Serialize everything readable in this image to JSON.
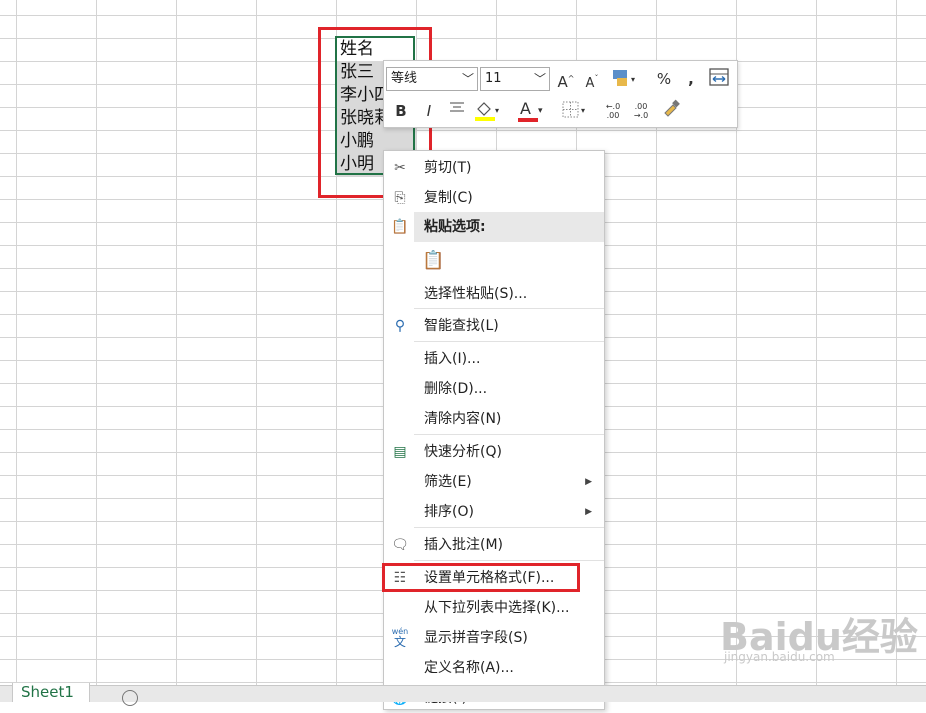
{
  "cells": [
    "姓名",
    "张三",
    "李小四",
    "张晓莉",
    "小鹏",
    "小明"
  ],
  "mini_toolbar": {
    "font_name": "等线",
    "font_size": "11",
    "increase_font_label": "A",
    "decrease_font_label": "A",
    "percent_label": "%",
    "comma_label": ",",
    "bold_label": "B",
    "italic_label": "I",
    "font_color_label": "A",
    "font_color": "#e0242a",
    "fill_color": "#ffff00",
    "inc_decimal_label": ".0\n.00",
    "dec_decimal_label": ".00\n.0"
  },
  "context_menu": {
    "items": [
      {
        "label": "剪切(T)",
        "icon": "scissors-icon"
      },
      {
        "label": "复制(C)",
        "icon": "copy-icon"
      },
      {
        "label": "粘贴选项:",
        "icon": "paste-icon"
      },
      {
        "label": "选择性粘贴(S)...",
        "icon": ""
      },
      {
        "label": "智能查找(L)",
        "icon": "smart-lookup-icon"
      },
      {
        "label": "插入(I)...",
        "icon": ""
      },
      {
        "label": "删除(D)...",
        "icon": ""
      },
      {
        "label": "清除内容(N)",
        "icon": ""
      },
      {
        "label": "快速分析(Q)",
        "icon": "quick-analysis-icon"
      },
      {
        "label": "筛选(E)",
        "icon": ""
      },
      {
        "label": "排序(O)",
        "icon": ""
      },
      {
        "label": "插入批注(M)",
        "icon": "comment-icon"
      },
      {
        "label": "设置单元格格式(F)...",
        "icon": "format-cells-icon"
      },
      {
        "label": "从下拉列表中选择(K)...",
        "icon": ""
      },
      {
        "label": "显示拼音字段(S)",
        "icon": "pinyin-icon"
      },
      {
        "label": "定义名称(A)...",
        "icon": ""
      },
      {
        "label": "链接(I)",
        "icon": "link-icon"
      }
    ],
    "pinyin_icon_text": "wén"
  },
  "sheet_tab": "Sheet1",
  "watermark": {
    "main": "Baidu经验",
    "sub": "jingyan.baidu.com"
  },
  "colors": {
    "selection_border": "#217346",
    "highlight_red": "#e0242a"
  }
}
